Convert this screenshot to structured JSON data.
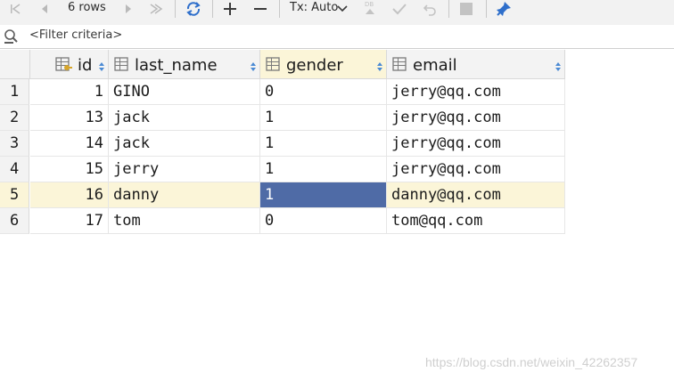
{
  "toolbar": {
    "rows_label": "6 rows",
    "tx_label": "Tx: Auto",
    "icons": [
      "first-page-icon",
      "prev-page-icon",
      "next-page-icon",
      "last-page-icon",
      "refresh-icon",
      "add-row-icon",
      "delete-row-icon",
      "commit-db-icon",
      "check-icon",
      "revert-icon",
      "stop-icon",
      "pin-icon"
    ]
  },
  "filter": {
    "placeholder": "<Filter criteria>"
  },
  "grid": {
    "columns": [
      {
        "name": "id",
        "key": true
      },
      {
        "name": "last_name"
      },
      {
        "name": "gender"
      },
      {
        "name": "email"
      }
    ],
    "rows": [
      {
        "num": "1",
        "id": "1",
        "last_name": "GINO",
        "gender": "0",
        "email": "jerry@qq.com"
      },
      {
        "num": "2",
        "id": "13",
        "last_name": "jack",
        "gender": "1",
        "email": "jerry@qq.com"
      },
      {
        "num": "3",
        "id": "14",
        "last_name": "jack",
        "gender": "1",
        "email": "jerry@qq.com"
      },
      {
        "num": "4",
        "id": "15",
        "last_name": "jerry",
        "gender": "1",
        "email": "jerry@qq.com"
      },
      {
        "num": "5",
        "id": "16",
        "last_name": "danny",
        "gender": "1",
        "email": "danny@qq.com"
      },
      {
        "num": "6",
        "id": "17",
        "last_name": "tom",
        "gender": "0",
        "email": "tom@qq.com"
      }
    ],
    "selected_row_index": 4,
    "selected_column": "gender",
    "colors": {
      "selected_row": "#fbf5d8",
      "active_cell": "#4f6ba6",
      "accent_icon": "#2f6fcb"
    }
  },
  "watermark": "https://blog.csdn.net/weixin_42262357"
}
